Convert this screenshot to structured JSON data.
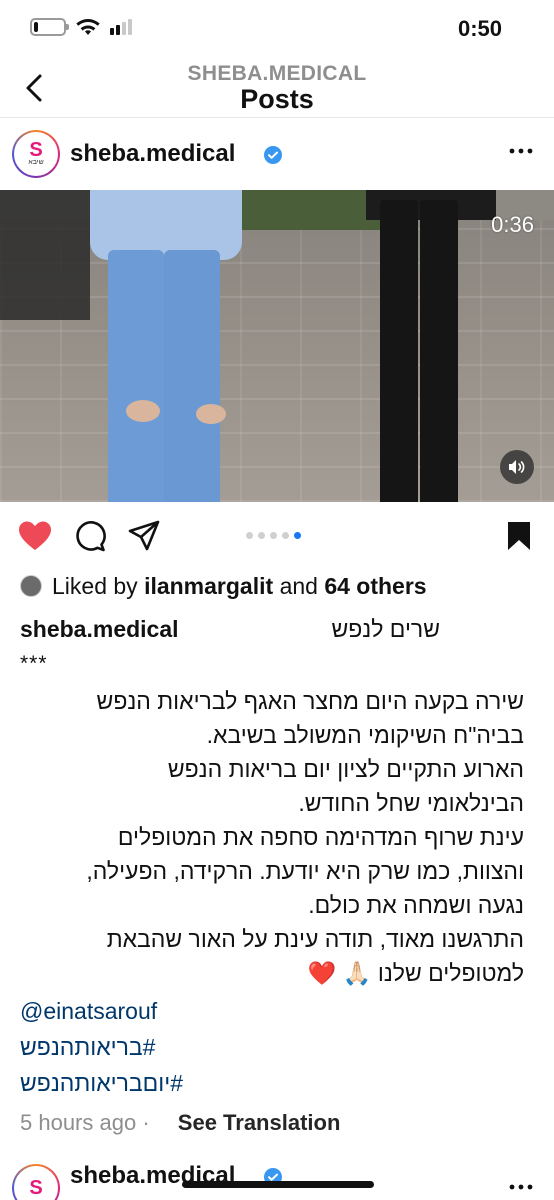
{
  "status_bar": {
    "time": "0:50",
    "battery_level": 0.15
  },
  "header": {
    "account": "SHEBA.MEDICAL",
    "title": "Posts"
  },
  "post": {
    "username": "sheba.medical",
    "avatar_initial": "S",
    "avatar_word": "שיבא",
    "media": {
      "duration": "0:36",
      "carousel_total": 5,
      "carousel_active": 5
    },
    "liked_by": {
      "prefix": "Liked by",
      "user": "ilanmargalit",
      "middle": "and",
      "others": "64 others"
    },
    "caption": {
      "username": "sheba.medical",
      "title": "שרים לנפש",
      "stars": "***",
      "lines": [
        "שירה בקעה היום מחצר האגף לבריאות הנפש",
        "בביה\"ח השיקומי המשולב בשיבא.",
        "הארוע התקיים לציון יום בריאות הנפש",
        "הבינלאומי שחל החודש.",
        "עינת שרוף המדהימה סחפה את המטופלים",
        "והצוות, כמו שרק היא יודעת. הרקידה, הפעילה,",
        "נגעה ושמחה את כולם.",
        "התרגשנו מאוד, תודה עינת על האור שהבאת",
        "למטופלים שלנו 🙏🏻 ❤️"
      ],
      "mention": "@einatsarouf",
      "hashtags": [
        "#בריאותהנפש",
        "#יוםבריאותהנפש"
      ]
    },
    "time_ago": "5 hours ago",
    "see_translation": "See Translation"
  },
  "next_post": {
    "username": "sheba.medical"
  },
  "colors": {
    "like_red": "#ed4956",
    "link_blue": "#00376b",
    "verified_blue": "#3897f0",
    "carousel_active": "#1877f2"
  }
}
